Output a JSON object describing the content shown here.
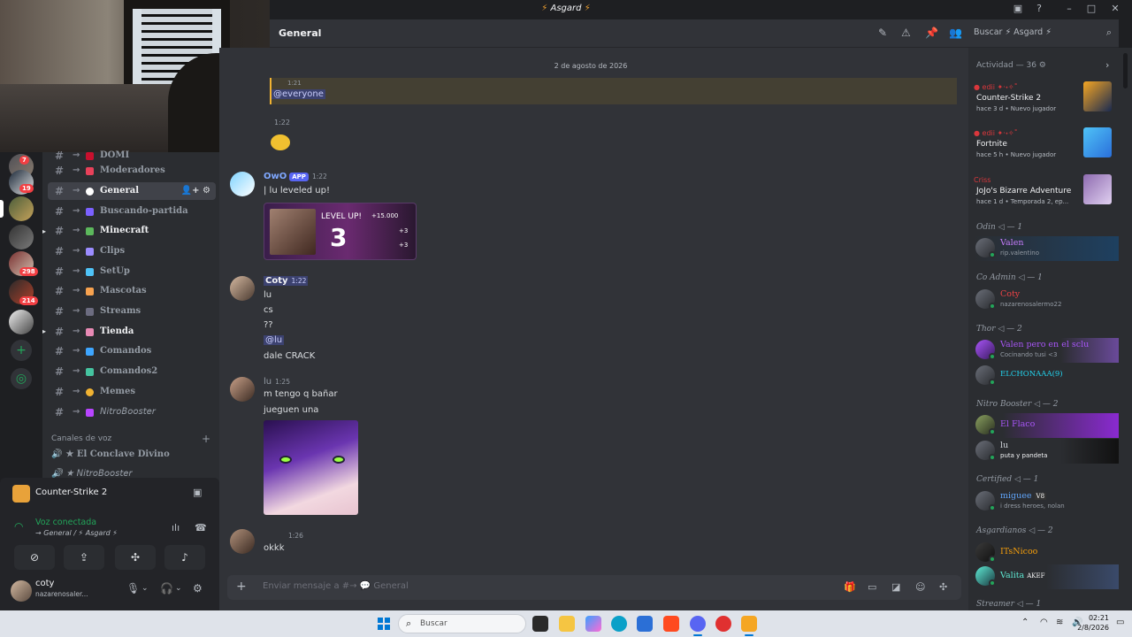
{
  "window": {
    "title": "Asgard",
    "bolt": "⚡"
  },
  "header": {
    "channel_name": "General"
  },
  "search": {
    "placeholder": "Buscar ⚡ Asgard ⚡"
  },
  "channels": {
    "items": [
      {
        "name": "DOMI",
        "top": 0
      },
      {
        "name": "Moderadores"
      },
      {
        "name": "General"
      },
      {
        "name": "Buscando-partida"
      },
      {
        "name": "Minecraft"
      },
      {
        "name": "Clips"
      },
      {
        "name": "SetUp"
      },
      {
        "name": "Mascotas"
      },
      {
        "name": "Streams"
      },
      {
        "name": "Tienda"
      },
      {
        "name": "Comandos"
      },
      {
        "name": "Comandos2"
      },
      {
        "name": "Memes"
      },
      {
        "name": "𝘕𝘪𝘵𝘳𝘰𝘉𝘰𝘰𝘴𝘵𝘦𝘳"
      }
    ],
    "voice_section": "Canales de voz",
    "voice_channels": [
      {
        "name": "★ El Conclave Divino"
      },
      {
        "name": "★ 𝘕𝘪𝘵𝘳𝘰𝘉𝘰𝘰𝘴𝘵𝘦𝘳"
      }
    ]
  },
  "servers": {
    "badges": [
      "7",
      "19",
      "298",
      "214"
    ]
  },
  "rtc": {
    "game": "Counter-Strike 2",
    "status": "Voz conectada",
    "location": "→ General / ⚡ Asgard ⚡"
  },
  "user": {
    "name": "coty",
    "status": "nazarenosaler..."
  },
  "chat": {
    "date": "2 de agosto de 2026",
    "messages": [
      {
        "time": "1:21",
        "text": "@everyone"
      },
      {
        "time": "1:22"
      },
      {
        "author": "OwO",
        "tag": "APP",
        "time": "1:22",
        "text": "| lu leveled up!",
        "card": {
          "label": "LEVEL UP!",
          "level": "3",
          "rewards": [
            "+15.000",
            "+3",
            "+3"
          ]
        }
      },
      {
        "author": "Coty",
        "time": "1:22",
        "lines": [
          "lu",
          "cs",
          "??",
          "@lu",
          "dale CRACK"
        ]
      },
      {
        "author": "lu",
        "time": "1:25",
        "lines": [
          "m tengo q bañar",
          "jueguen una"
        ]
      },
      {
        "time": "1:26",
        "text": "okkk"
      }
    ]
  },
  "composer": {
    "placeholder": "Enviar mensaje a #→",
    "channel": "General"
  },
  "members": {
    "activity_header": "Actividad — 36",
    "activity": [
      {
        "game": "Counter-Strike 2",
        "meta": "hace 3 d  •  Nuevo jugador",
        "color": "#f5a623"
      },
      {
        "game": "Fortnite",
        "meta": "hace 5 h  •  Nuevo jugador",
        "color": "#4fc3f7"
      },
      {
        "user": "Criss",
        "game": "JoJo's Bizarre Adventure",
        "meta": "hace 1 d  •  Temporada 2, ep...",
        "color": "#8e6bb0"
      }
    ],
    "groups": [
      {
        "title": "Odin ◁ — 1",
        "members": [
          {
            "name": "Valen",
            "sub": "rip.valentino",
            "color": "#c77dff"
          }
        ]
      },
      {
        "title": "Co Admin ◁ — 1",
        "members": [
          {
            "name": "Coty",
            "sub": "nazarenosalermo22",
            "color": "#ed4245"
          }
        ]
      },
      {
        "title": "Thor ◁ — 2",
        "members": [
          {
            "name": "Valen pero en el sclu",
            "sub": "Cocinando tusi <3",
            "color": "#a855f7"
          },
          {
            "name": "ELCHONAAA(9)",
            "sub": "",
            "color": "#22d3ee"
          }
        ]
      },
      {
        "title": "Nitro Booster ◁ — 2",
        "members": [
          {
            "name": "El Flaco",
            "sub": "",
            "color": "#a855f7"
          },
          {
            "name": "lu",
            "sub": "puta y pandeta",
            "color": "#d1d5db"
          }
        ]
      },
      {
        "title": "Certified ◁ — 1",
        "members": [
          {
            "name": "miguee",
            "sub": "i dress heroes, nolan",
            "color": "#60a5fa",
            "tag": "V8"
          }
        ]
      },
      {
        "title": "Asgardianos ◁ — 2",
        "members": [
          {
            "name": "ITsNicoo",
            "sub": "",
            "color": "#f59e0b"
          },
          {
            "name": "Valita",
            "sub": "",
            "color": "#5eead4",
            "tag": "AKEF"
          }
        ]
      },
      {
        "title": "Streamer ◁ — 1",
        "members": []
      }
    ]
  },
  "taskbar": {
    "search": "Buscar",
    "time": "02:21",
    "date": "2/8/2026"
  },
  "colors": {
    "accent": "#5865f2",
    "online": "#23a55a",
    "mention": "#f0b232"
  }
}
